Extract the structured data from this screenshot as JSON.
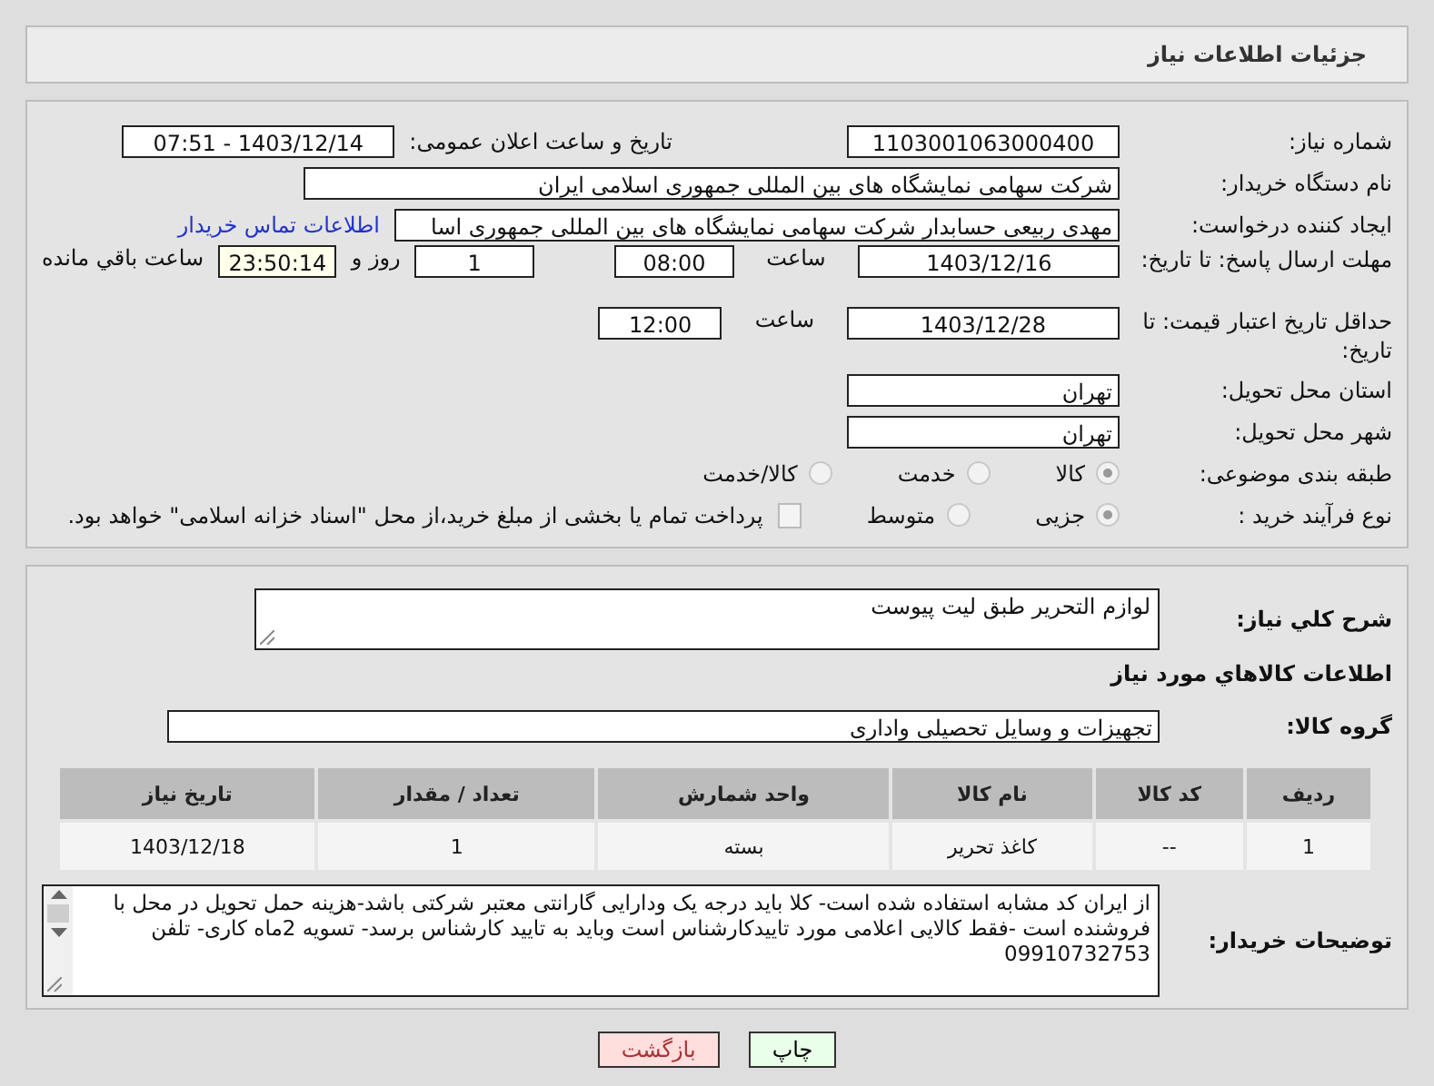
{
  "header": {
    "title": "جزئیات اطلاعات نیاز"
  },
  "need_number": {
    "label": "شماره نیاز:",
    "value": "1103001063000400"
  },
  "announce": {
    "label": "تاریخ و ساعت اعلان عمومی:",
    "value": "1403/12/14 - 07:51"
  },
  "buyer": {
    "label": "نام دستگاه خریدار:",
    "value": "شرکت سهامی نمایشگاه های بین المللی جمهوری اسلامی ایران"
  },
  "requester": {
    "label": "ایجاد کننده درخواست:",
    "value": "مهدی  ربیعی حسابدار شرکت سهامی نمایشگاه های بین المللی جمهوری اسا",
    "link": "اطلاعات تماس خریدار"
  },
  "deadline": {
    "label": "مهلت ارسال پاسخ: تا تاریخ:",
    "date": "1403/12/16",
    "time_label": "ساعت",
    "time": "08:00",
    "days": "1",
    "days_label": "روز و",
    "remaining": "23:50:14",
    "remaining_label": "ساعت باقي مانده"
  },
  "validity": {
    "label": "حداقل تاریخ اعتبار قیمت: تا تاریخ:",
    "date": "1403/12/28",
    "time_label": "ساعت",
    "time": "12:00"
  },
  "province": {
    "label": "استان محل تحویل:",
    "value": "تهران"
  },
  "city": {
    "label": "شهر محل تحویل:",
    "value": "تهران"
  },
  "category": {
    "label": "طبقه بندی موضوعی:",
    "options": [
      {
        "label": "کالا",
        "selected": true
      },
      {
        "label": "خدمت",
        "selected": false
      },
      {
        "label": "کالا/خدمت",
        "selected": false
      }
    ]
  },
  "purchase_type": {
    "label": "نوع فرآیند خرید :",
    "options": [
      {
        "label": "جزیی",
        "selected": true
      },
      {
        "label": "متوسط",
        "selected": false
      }
    ],
    "payment": {
      "checked": false,
      "text": "پرداخت تمام یا بخشی از مبلغ خرید،از محل \"اسناد خزانه اسلامی\" خواهد بود."
    }
  },
  "description": {
    "label": "شرح کلي نیاز:",
    "value": "لوازم التحریر طبق لیت پیوست"
  },
  "goods_heading": "اطلاعات کالاهاي مورد نیاز",
  "goods_group": {
    "label": "گروه کالا:",
    "value": "تجهیزات و وسایل تحصیلی واداری"
  },
  "table": {
    "columns": [
      "ردیف",
      "کد کالا",
      "نام کالا",
      "واحد شمارش",
      "تعداد / مقدار",
      "تاریخ نیاز"
    ],
    "rows": [
      [
        "1",
        "--",
        "کاغذ تحریر",
        "بسته",
        "1",
        "1403/12/18"
      ]
    ]
  },
  "buyer_notes": {
    "label": "توضیحات خریدار:",
    "value": "از ایران کد مشابه استفاده شده است- کلا باید درجه یک  ودارایی گارانتی معتبر شرکتی باشد-هزینه حمل تحویل در محل با فروشنده است -فقط کالایی اعلامی مورد تاییدکارشناس  است وباید به تایید کارشناس برسد- تسویه 2ماه کاری- تلفن 09910732753"
  },
  "buttons": [
    {
      "kind": "print",
      "label": "چاپ"
    },
    {
      "kind": "back",
      "label": "بازگشت"
    }
  ]
}
